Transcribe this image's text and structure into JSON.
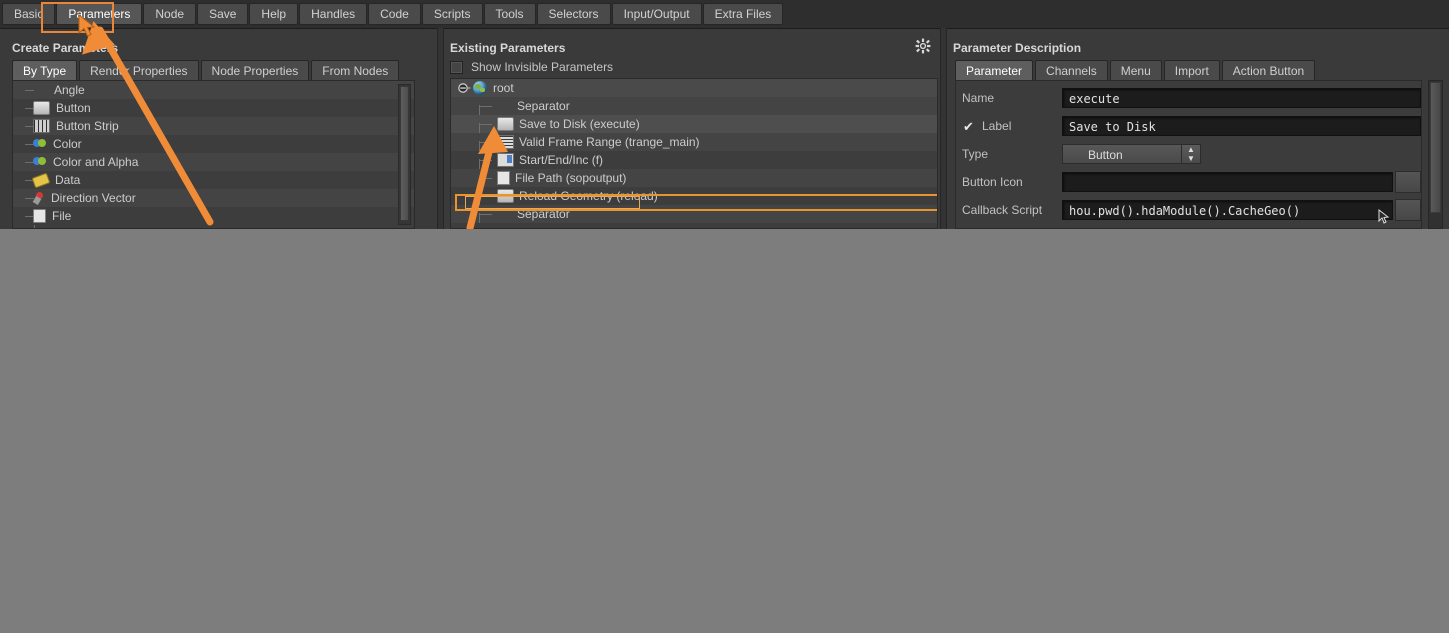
{
  "window": {
    "background_color": "#7d7d7d",
    "panel_color": "#3a3a3a",
    "accent_color": "#e8863a"
  },
  "top_tabs": [
    {
      "label": "Basic",
      "active": false
    },
    {
      "label": "Parameters",
      "active": true
    },
    {
      "label": "Node",
      "active": false
    },
    {
      "label": "Save",
      "active": false
    },
    {
      "label": "Help",
      "active": false
    },
    {
      "label": "Handles",
      "active": false
    },
    {
      "label": "Code",
      "active": false
    },
    {
      "label": "Scripts",
      "active": false
    },
    {
      "label": "Tools",
      "active": false
    },
    {
      "label": "Selectors",
      "active": false
    },
    {
      "label": "Input/Output",
      "active": false
    },
    {
      "label": "Extra Files",
      "active": false
    }
  ],
  "left_panel": {
    "title": "Create Parameters",
    "tabs": [
      {
        "label": "By Type",
        "active": true
      },
      {
        "label": "Render Properties",
        "active": false
      },
      {
        "label": "Node Properties",
        "active": false
      },
      {
        "label": "From Nodes",
        "active": false
      }
    ],
    "items": [
      {
        "label": "Angle",
        "icon": "angle-icon"
      },
      {
        "label": "Button",
        "icon": "button-icon"
      },
      {
        "label": "Button Strip",
        "icon": "button-strip-icon"
      },
      {
        "label": "Color",
        "icon": "color-icon"
      },
      {
        "label": "Color and Alpha",
        "icon": "color-alpha-icon"
      },
      {
        "label": "Data",
        "icon": "data-icon"
      },
      {
        "label": "Direction Vector",
        "icon": "direction-vector-icon"
      },
      {
        "label": "File",
        "icon": "file-icon"
      }
    ]
  },
  "middle_panel": {
    "title": "Existing Parameters",
    "gear_icon": "gear-icon",
    "show_invisible": {
      "label": "Show Invisible Parameters",
      "checked": false
    },
    "root": {
      "label": "root",
      "icon": "globe-icon",
      "expanded": true
    },
    "items": [
      {
        "label": "Separator",
        "icon": "separator-icon",
        "selected": false
      },
      {
        "label": "Save to Disk (execute)",
        "icon": "button-icon",
        "selected": true
      },
      {
        "label": "Valid Frame Range (trange_main)",
        "icon": "menu-icon",
        "selected": false
      },
      {
        "label": "Start/End/Inc (f)",
        "icon": "integer-icon",
        "selected": false
      },
      {
        "label": "File Path (sopoutput)",
        "icon": "string-icon",
        "selected": false
      },
      {
        "label": "Reload Geometry (reload)",
        "icon": "button-icon",
        "selected": false
      },
      {
        "label": "Separator",
        "icon": "separator-icon",
        "selected": false
      }
    ]
  },
  "right_panel": {
    "title": "Parameter Description",
    "tabs": [
      {
        "label": "Parameter",
        "active": true
      },
      {
        "label": "Channels",
        "active": false
      },
      {
        "label": "Menu",
        "active": false
      },
      {
        "label": "Import",
        "active": false
      },
      {
        "label": "Action Button",
        "active": false
      }
    ],
    "fields": {
      "name": {
        "label": "Name",
        "value": "execute"
      },
      "label": {
        "label": "Label",
        "value": "Save to Disk",
        "checked": true
      },
      "type": {
        "label": "Type",
        "value": "Button"
      },
      "button_icon": {
        "label": "Button Icon",
        "value": ""
      },
      "callback_script": {
        "label": "Callback Script",
        "value": "hou.pwd().hdaModule().CacheGeo()"
      }
    }
  },
  "annotations": {
    "arrow_color": "#f08c38",
    "arrow_1_target": "Parameters tab",
    "arrow_2_target": "Save to Disk (execute) row",
    "highlight_boxes": [
      "parameters-tab",
      "save-to-disk-row",
      "callback-script-field"
    ]
  }
}
